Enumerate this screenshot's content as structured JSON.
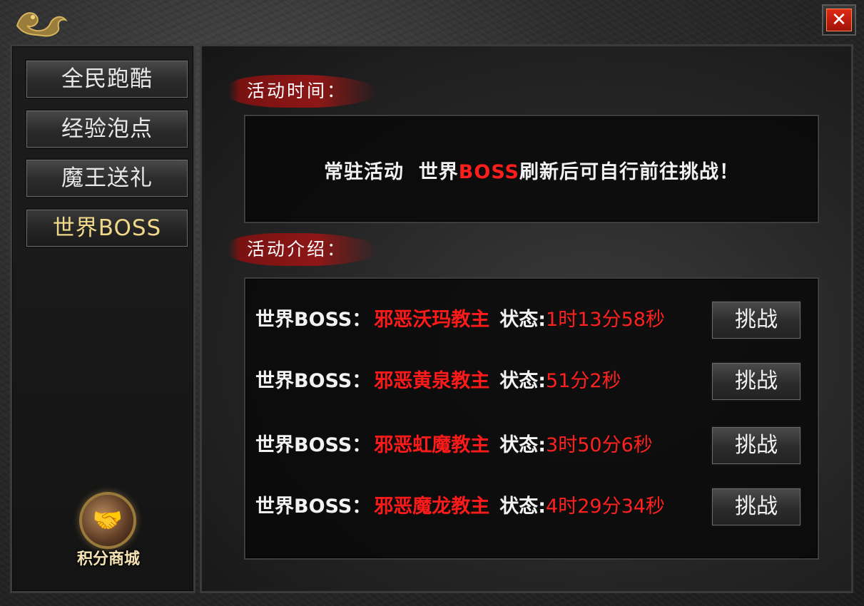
{
  "window": {
    "close_symbol": "✕"
  },
  "sidebar": {
    "items": [
      {
        "label": "全民跑酷"
      },
      {
        "label": "经验泡点"
      },
      {
        "label": "魔王送礼"
      },
      {
        "label": "世界BOSS"
      }
    ],
    "keys": [
      "F9",
      "D"
    ],
    "shop": {
      "label": "积分商城",
      "icon": "handshake-icon"
    }
  },
  "time_section": {
    "label": "活动时间：",
    "notice_part1": "常驻活动  世界",
    "notice_highlight": "BOSS",
    "notice_part2": "刷新后可自行前往挑战！"
  },
  "intro_section": {
    "label": "活动介绍：",
    "bosses": [
      {
        "prefix": "世界BOSS：",
        "name": "邪恶沃玛教主",
        "state_label": "状态:",
        "timer": "1时13分58秒",
        "button": "挑战"
      },
      {
        "prefix": "世界BOSS：",
        "name": "邪恶黄泉教主",
        "state_label": "状态:",
        "timer": "51分2秒",
        "button": "挑战"
      },
      {
        "prefix": "世界BOSS：",
        "name": "邪恶虹魔教主",
        "state_label": "状态:",
        "timer": "3时50分6秒",
        "button": "挑战"
      },
      {
        "prefix": "世界BOSS：",
        "name": "邪恶魔龙教主",
        "state_label": "状态:",
        "timer": "4时29分34秒",
        "button": "挑战"
      }
    ]
  },
  "colors": {
    "accent_red": "#ff1e1e",
    "active_nav": "#f0d88a"
  }
}
